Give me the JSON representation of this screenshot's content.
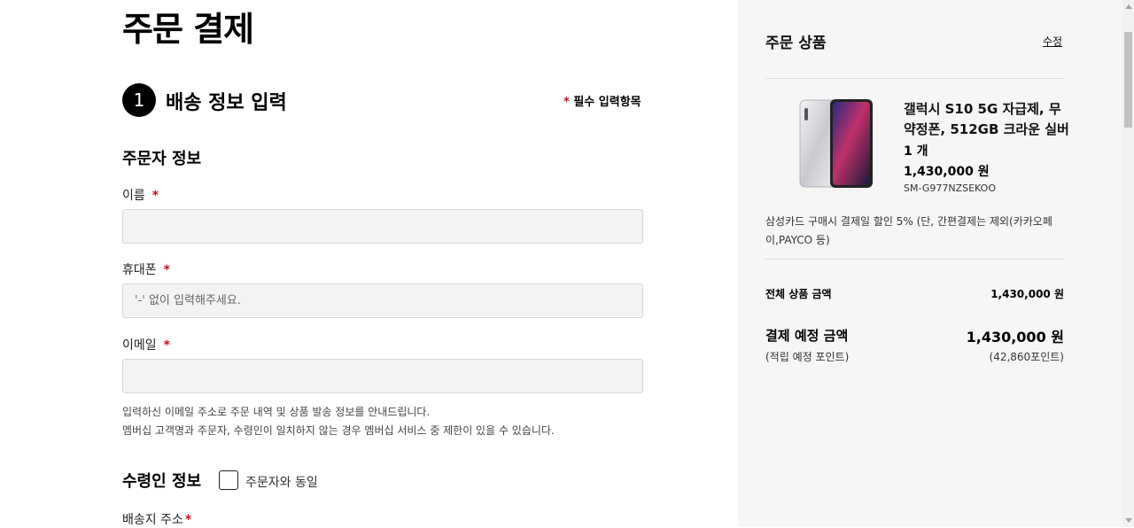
{
  "page": {
    "title": "주문 결제"
  },
  "step": {
    "number": "1",
    "title": "배송 정보 입력"
  },
  "required_note": {
    "star": "*",
    "text": "필수 입력항목"
  },
  "orderer": {
    "section_title": "주문자 정보",
    "name": {
      "label": "이름",
      "value": "",
      "placeholder": ""
    },
    "phone": {
      "label": "휴대폰",
      "value": "",
      "placeholder": "'-' 없이 입력해주세요."
    },
    "email": {
      "label": "이메일",
      "value": "",
      "placeholder": ""
    },
    "hint_lines": [
      "입력하신 이메일 주소로 주문 내역 및 상품 발송 정보를 안내드립니다.",
      "멤버십 고객명과 주문자, 수령인이 일치하지 않는 경우 멤버십 서비스 중 제한이 있을 수 있습니다."
    ]
  },
  "receiver": {
    "section_title": "수령인 정보",
    "same_as_orderer": {
      "label": "주문자와 동일",
      "checked": false
    },
    "address_label": "배송지 주소"
  },
  "order_summary": {
    "title": "주문 상품",
    "edit_label": "수정",
    "product": {
      "name": "갤럭시 S10 5G 자급제, 무약정폰, 512GB 크라운 실버",
      "quantity": "1 개",
      "price": "1,430,000 원",
      "sku": "SM-G977NZSEKOO",
      "image_icon": "phone-image"
    },
    "promo": "삼성카드 구매시 결제일 할인 5% (단, 간편결제는 제외(카카오페이,PAYCO 등)",
    "total_label": "전체 상품 금액",
    "total_value": "1,430,000 원",
    "pay_label": "결제 예정 금액",
    "pay_value": "1,430,000 원",
    "points_label": "(적립 예정 포인트)",
    "points_value": "(42,860포인트)"
  },
  "colors": {
    "accent_required": "#c1121f",
    "panel_bg": "#f6f6f6",
    "input_bg": "#f3f3f3"
  }
}
